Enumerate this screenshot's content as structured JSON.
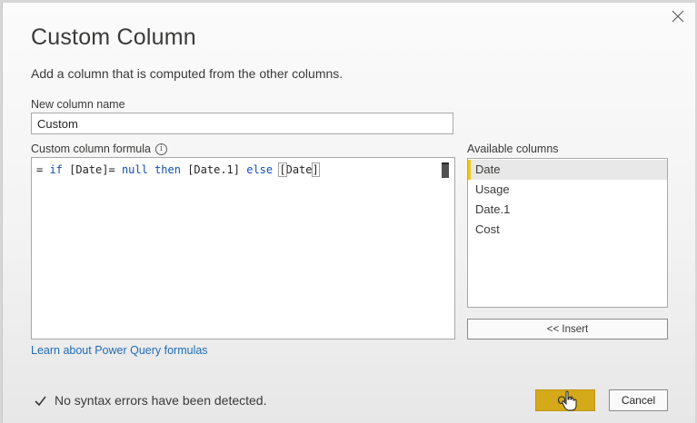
{
  "dialog": {
    "title": "Custom Column",
    "subtitle": "Add a column that is computed from the other columns.",
    "close_icon": "close-icon"
  },
  "new_column": {
    "label": "New column name",
    "value": "Custom"
  },
  "formula": {
    "label": "Custom column formula",
    "info_icon": "info-icon",
    "tokens": {
      "eq": "= ",
      "if": "if",
      "part1": " [Date]= ",
      "null": "null",
      "sp1": " ",
      "then": "then",
      "part2": " [Date.1] ",
      "else": "else",
      "sp2": " ",
      "bracket_open": "[",
      "date": "Date",
      "bracket_close": "]"
    },
    "full_text": "= if [Date]= null then [Date.1] else [Date]"
  },
  "available_columns": {
    "label": "Available columns",
    "items": [
      "Date",
      "Usage",
      "Date.1",
      "Cost"
    ],
    "selected": "Date",
    "insert_label": "<< Insert"
  },
  "learn_link": "Learn about Power Query formulas",
  "status": {
    "icon": "checkmark-icon",
    "text": "No syntax errors have been detected."
  },
  "buttons": {
    "ok_label": "OK",
    "cancel_label": "Cancel"
  },
  "colors": {
    "accent": "#f2c811",
    "ok_button": "#d4a91a",
    "keyword": "#0f4fb8",
    "link": "#1f6bb8"
  }
}
